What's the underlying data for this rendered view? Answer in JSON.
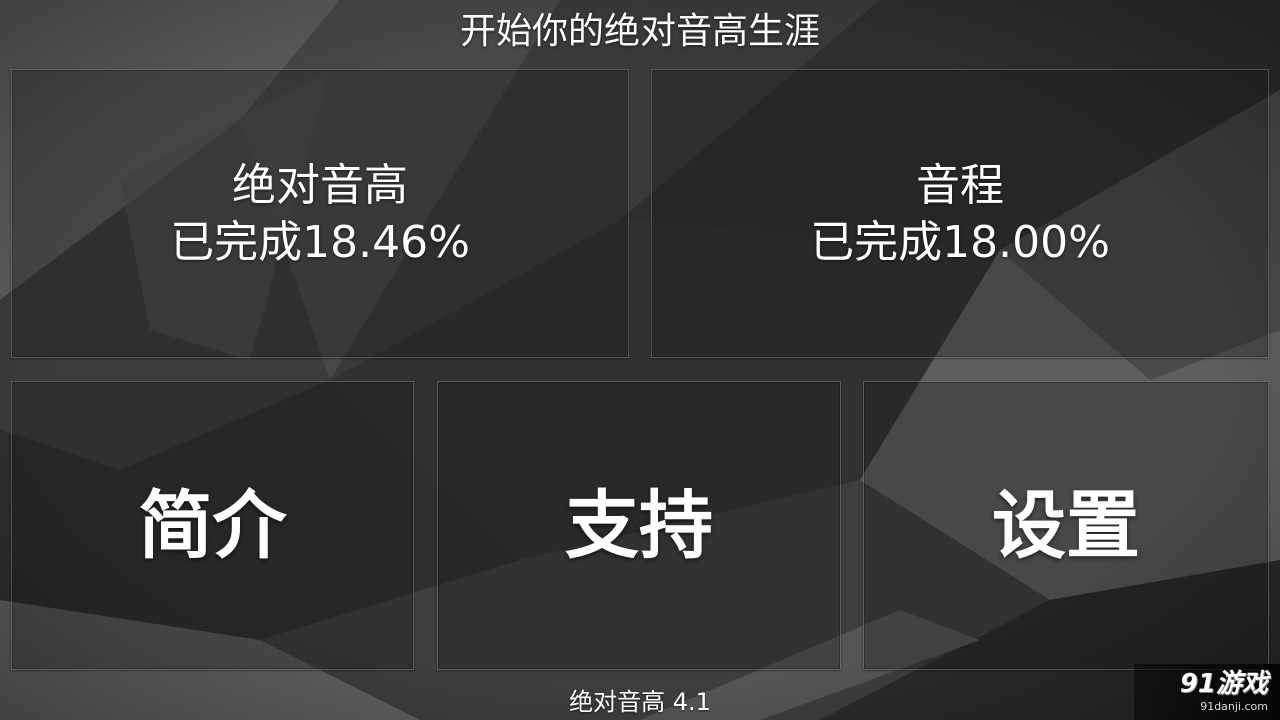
{
  "header": {
    "title": "开始你的绝对音高生涯"
  },
  "modes": [
    {
      "name": "绝对音高",
      "progress_label": "已完成",
      "progress_value": "18.46%"
    },
    {
      "name": "音程",
      "progress_label": "已完成",
      "progress_value": "18.00%"
    }
  ],
  "menu": {
    "items": [
      {
        "label": "简介"
      },
      {
        "label": "支持"
      },
      {
        "label": "设置"
      }
    ]
  },
  "footer": {
    "version_text": "绝对音高 4.1"
  },
  "watermark": {
    "brand": "91游戏",
    "site": "91danji.com"
  },
  "colors": {
    "text": "#ffffff",
    "background": "#353535"
  }
}
